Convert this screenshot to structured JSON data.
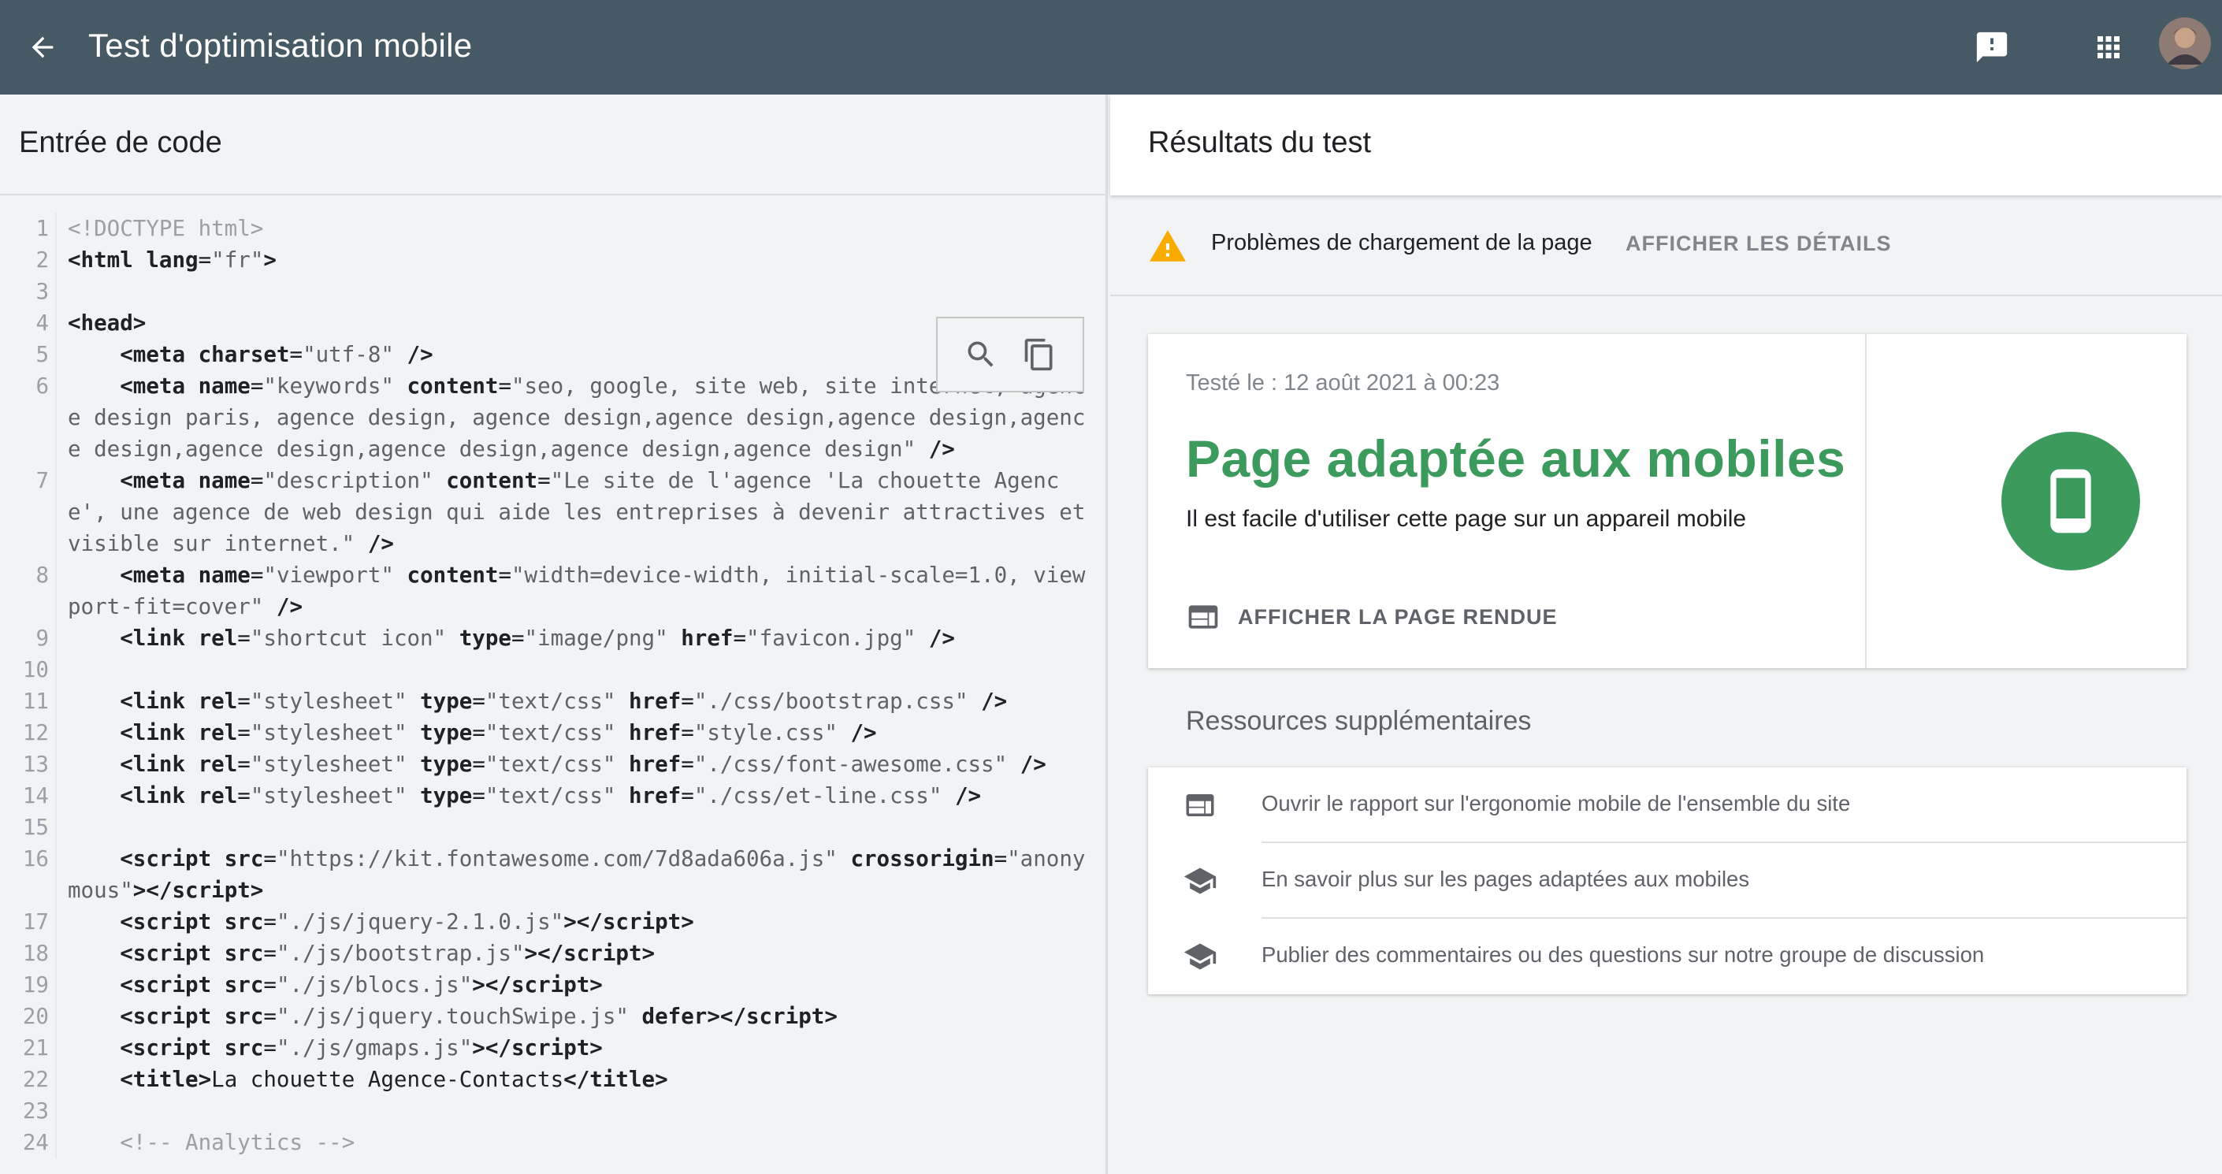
{
  "appbar": {
    "title": "Test d'optimisation mobile"
  },
  "left": {
    "heading": "Entrée de code",
    "code_lines": [
      {
        "n": "1",
        "html": "<span class='cmt'>&lt;!DOCTYPE html&gt;</span>"
      },
      {
        "n": "2",
        "html": "<span class='tag'>&lt;html</span> <span class='attr'>lang</span>=<span class='val'>\"fr\"</span><span class='tag'>&gt;</span>"
      },
      {
        "n": "3",
        "html": ""
      },
      {
        "n": "4",
        "html": "<span class='tag'>&lt;head&gt;</span>"
      },
      {
        "n": "5",
        "html": "    <span class='tag'>&lt;meta</span> <span class='attr'>charset</span>=<span class='val'>\"utf-8\"</span> <span class='tag'>/&gt;</span>"
      },
      {
        "n": "6",
        "html": "    <span class='tag'>&lt;meta</span> <span class='attr'>name</span>=<span class='val'>\"keywords\"</span> <span class='attr'>content</span>=<span class='val'>\"seo, google, site web, site internet, agence design paris, agence design, agence design,agence design,agence design,agence design,agence design,agence design,agence design,agence design\"</span> <span class='tag'>/&gt;</span>"
      },
      {
        "n": "7",
        "html": "    <span class='tag'>&lt;meta</span> <span class='attr'>name</span>=<span class='val'>\"description\"</span> <span class='attr'>content</span>=<span class='val'>\"Le site de l'agence 'La chouette Agence', une agence de web design qui aide les entreprises à devenir attractives et visible sur internet.\"</span> <span class='tag'>/&gt;</span>"
      },
      {
        "n": "8",
        "html": "    <span class='tag'>&lt;meta</span> <span class='attr'>name</span>=<span class='val'>\"viewport\"</span> <span class='attr'>content</span>=<span class='val'>\"width=device-width, initial-scale=1.0, viewport-fit=cover\"</span> <span class='tag'>/&gt;</span>"
      },
      {
        "n": "9",
        "html": "    <span class='tag'>&lt;link</span> <span class='attr'>rel</span>=<span class='val'>\"shortcut icon\"</span> <span class='attr'>type</span>=<span class='val'>\"image/png\"</span> <span class='attr'>href</span>=<span class='val'>\"favicon.jpg\"</span> <span class='tag'>/&gt;</span>"
      },
      {
        "n": "10",
        "html": ""
      },
      {
        "n": "11",
        "html": "    <span class='tag'>&lt;link</span> <span class='attr'>rel</span>=<span class='val'>\"stylesheet\"</span> <span class='attr'>type</span>=<span class='val'>\"text/css\"</span> <span class='attr'>href</span>=<span class='val'>\"./css/bootstrap.css\"</span> <span class='tag'>/&gt;</span>"
      },
      {
        "n": "12",
        "html": "    <span class='tag'>&lt;link</span> <span class='attr'>rel</span>=<span class='val'>\"stylesheet\"</span> <span class='attr'>type</span>=<span class='val'>\"text/css\"</span> <span class='attr'>href</span>=<span class='val'>\"style.css\"</span> <span class='tag'>/&gt;</span>"
      },
      {
        "n": "13",
        "html": "    <span class='tag'>&lt;link</span> <span class='attr'>rel</span>=<span class='val'>\"stylesheet\"</span> <span class='attr'>type</span>=<span class='val'>\"text/css\"</span> <span class='attr'>href</span>=<span class='val'>\"./css/font-awesome.css\"</span> <span class='tag'>/&gt;</span>"
      },
      {
        "n": "14",
        "html": "    <span class='tag'>&lt;link</span> <span class='attr'>rel</span>=<span class='val'>\"stylesheet\"</span> <span class='attr'>type</span>=<span class='val'>\"text/css\"</span> <span class='attr'>href</span>=<span class='val'>\"./css/et-line.css\"</span> <span class='tag'>/&gt;</span>"
      },
      {
        "n": "15",
        "html": ""
      },
      {
        "n": "16",
        "html": "    <span class='tag'>&lt;script</span> <span class='attr'>src</span>=<span class='val'>\"https://kit.fontawesome.com/7d8ada606a.js\"</span> <span class='attr'>crossorigin</span>=<span class='val'>\"anonymous\"</span><span class='tag'>&gt;&lt;/script&gt;</span>"
      },
      {
        "n": "17",
        "html": "    <span class='tag'>&lt;script</span> <span class='attr'>src</span>=<span class='val'>\"./js/jquery-2.1.0.js\"</span><span class='tag'>&gt;&lt;/script&gt;</span>"
      },
      {
        "n": "18",
        "html": "    <span class='tag'>&lt;script</span> <span class='attr'>src</span>=<span class='val'>\"./js/bootstrap.js\"</span><span class='tag'>&gt;&lt;/script&gt;</span>"
      },
      {
        "n": "19",
        "html": "    <span class='tag'>&lt;script</span> <span class='attr'>src</span>=<span class='val'>\"./js/blocs.js\"</span><span class='tag'>&gt;&lt;/script&gt;</span>"
      },
      {
        "n": "20",
        "html": "    <span class='tag'>&lt;script</span> <span class='attr'>src</span>=<span class='val'>\"./js/jquery.touchSwipe.js\"</span> <span class='attr'>defer</span><span class='tag'>&gt;&lt;/script&gt;</span>"
      },
      {
        "n": "21",
        "html": "    <span class='tag'>&lt;script</span> <span class='attr'>src</span>=<span class='val'>\"./js/gmaps.js\"</span><span class='tag'>&gt;&lt;/script&gt;</span>"
      },
      {
        "n": "22",
        "html": "    <span class='tag'>&lt;title&gt;</span>La chouette Agence-Contacts<span class='tag'>&lt;/title&gt;</span>"
      },
      {
        "n": "23",
        "html": ""
      },
      {
        "n": "24",
        "html": "    <span class='cmt'>&lt;!-- Analytics --&gt;</span>"
      }
    ]
  },
  "right": {
    "heading": "Résultats du test",
    "warning": {
      "text": "Problèmes de chargement de la page",
      "link": "AFFICHER LES DÉTAILS"
    },
    "result": {
      "date": "Testé le : 12 août 2021 à 00:23",
      "verdict": "Page adaptée aux mobiles",
      "subtitle": "Il est facile d'utiliser cette page sur un appareil mobile",
      "rendered_link": "AFFICHER LA PAGE RENDUE"
    },
    "resources": {
      "title": "Ressources supplémentaires",
      "items": [
        {
          "label": "Ouvrir le rapport sur l'ergonomie mobile de l'ensemble du site",
          "icon": "report-icon"
        },
        {
          "label": "En savoir plus sur les pages adaptées aux mobiles",
          "icon": "school-icon"
        },
        {
          "label": "Publier des commentaires ou des questions sur notre groupe de discussion",
          "icon": "school-icon"
        }
      ]
    }
  },
  "colors": {
    "appbar": "#455a64",
    "success": "#3c9b5c",
    "warning": "#f9ab00"
  }
}
